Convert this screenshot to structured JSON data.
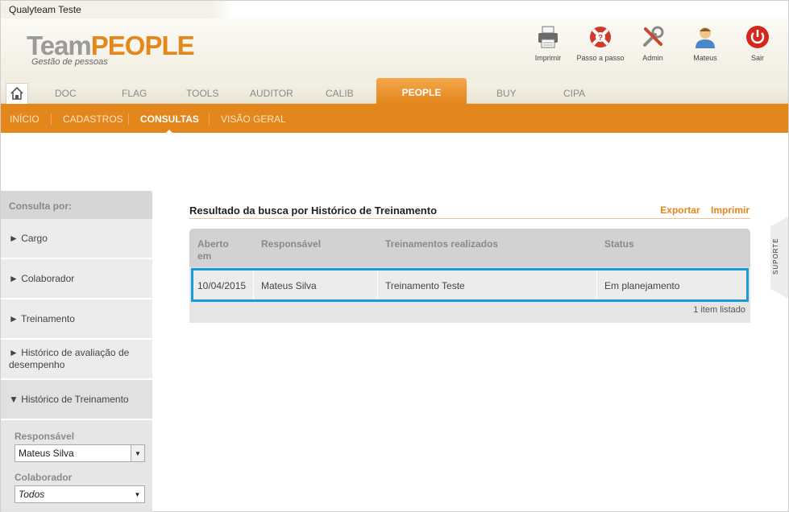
{
  "window": {
    "company": "Qualyteam Teste"
  },
  "logo": {
    "team": "Team",
    "people": "PEOPLE",
    "subtitle": "Gestão de pessoas"
  },
  "header_actions": [
    {
      "label": "Imprimir",
      "icon": "printer-icon"
    },
    {
      "label": "Passo a passo",
      "icon": "lifebuoy-icon"
    },
    {
      "label": "Admin",
      "icon": "tools-icon"
    },
    {
      "label": "Mateus",
      "icon": "user-avatar-icon"
    },
    {
      "label": "Sair",
      "icon": "power-icon"
    }
  ],
  "tabs": [
    "DOC",
    "FLAG",
    "TOOLS",
    "AUDITOR",
    "CALIB",
    "PEOPLE",
    "BUY",
    "CIPA"
  ],
  "active_tab": "PEOPLE",
  "subnav": [
    "INÍCIO",
    "CADASTROS",
    "CONSULTAS",
    "VISÃO GERAL"
  ],
  "active_subnav": "CONSULTAS",
  "sidebar": {
    "heading": "Consulta por:",
    "items": [
      "► Cargo",
      "► Colaborador",
      "► Treinamento",
      "► Histórico de avaliação de desempenho",
      "▼ Histórico de Treinamento"
    ],
    "form": {
      "responsavel_label": "Responsável",
      "responsavel_value": "Mateus Silva",
      "colaborador_label": "Colaborador",
      "colaborador_value": "Todos"
    }
  },
  "content": {
    "title": "Resultado da busca por Histórico de Treinamento",
    "export_label": "Exportar",
    "print_label": "Imprimir",
    "columns": [
      "Aberto em",
      "Responsável",
      "Treinamentos realizados",
      "Status"
    ],
    "rows": [
      [
        "10/04/2015",
        "Mateus Silva",
        "Treinamento Teste",
        "Em planejamento"
      ]
    ],
    "footer": "1 item listado"
  },
  "support_tab": "SUPORTE",
  "colors": {
    "accent": "#e3861b",
    "selection": "#1a9bd7"
  }
}
